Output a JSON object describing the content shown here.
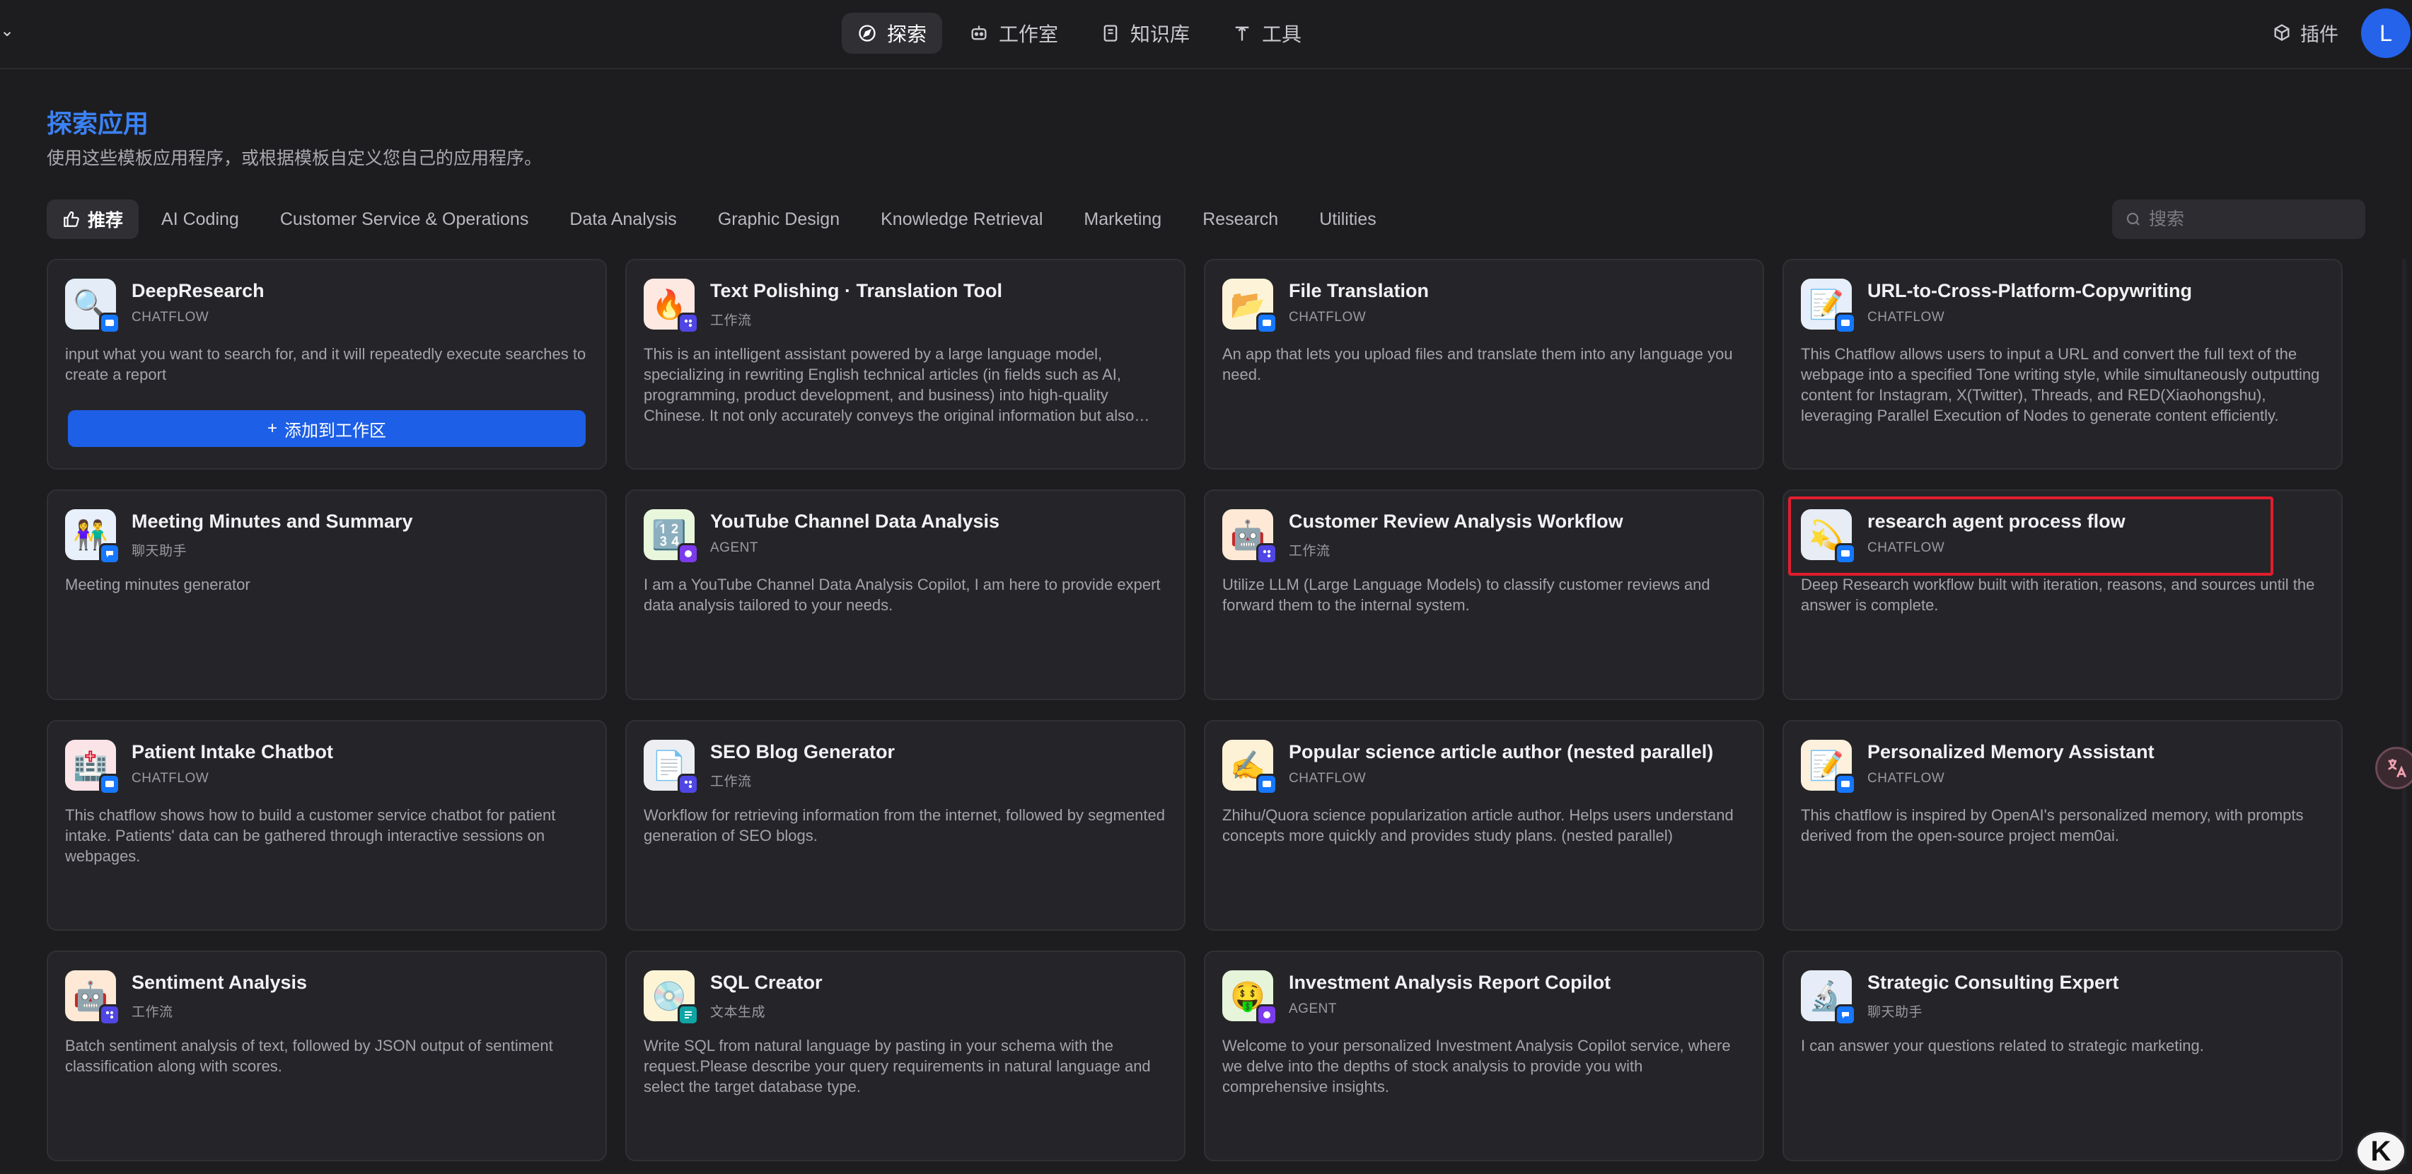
{
  "nav": {
    "items": [
      {
        "label": "探索",
        "icon": "compass-icon",
        "active": true
      },
      {
        "label": "工作室",
        "icon": "robot-icon",
        "active": false
      },
      {
        "label": "知识库",
        "icon": "book-icon",
        "active": false
      },
      {
        "label": "工具",
        "icon": "tool-icon",
        "active": false
      }
    ],
    "plugins_label": "插件",
    "avatar_letter": "L"
  },
  "page": {
    "title": "探索应用",
    "subtitle": "使用这些模板应用程序，或根据模板自定义您自己的应用程序。"
  },
  "categories": [
    {
      "label": "推荐",
      "active": true
    },
    {
      "label": "AI Coding"
    },
    {
      "label": "Customer Service & Operations"
    },
    {
      "label": "Data Analysis"
    },
    {
      "label": "Graphic Design"
    },
    {
      "label": "Knowledge Retrieval"
    },
    {
      "label": "Marketing"
    },
    {
      "label": "Research"
    },
    {
      "label": "Utilities"
    }
  ],
  "search": {
    "placeholder": "搜索"
  },
  "add_button_label": "添加到工作区",
  "cards": [
    {
      "name": "DeepResearch",
      "type": "CHATFLOW",
      "emoji": "🔍",
      "bg": "#e3ecf7",
      "badge": "#1677ff",
      "desc": "input what you want to search for, and it will repeatedly execute searches to create a report"
    },
    {
      "name": "Text Polishing · Translation Tool",
      "type": "工作流",
      "emoji": "🔥",
      "bg": "#fde8e2",
      "badge": "#4f46e5",
      "desc": "This is an intelligent assistant powered by a large language model, specializing in rewriting English technical articles (in fields such as AI, programming, product development, and business) into high-quality Chinese. It not only accurately conveys the original information but also ensures the translated text reads naturally and fluently."
    },
    {
      "name": "File Translation",
      "type": "CHATFLOW",
      "emoji": "📂",
      "bg": "#fdf3d8",
      "badge": "#1677ff",
      "desc": "An app that lets you upload files and translate them into any language you need."
    },
    {
      "name": "URL-to-Cross-Platform-Copywriting",
      "type": "CHATFLOW",
      "emoji": "📝",
      "bg": "#e6eefb",
      "badge": "#1677ff",
      "desc": "This Chatflow allows users to input a URL and convert the full text of the webpage into a specified Tone writing style, while simultaneously outputting content for Instagram, X(Twitter), Threads, and RED(Xiaohongshu), leveraging Parallel Execution of Nodes to generate content efficiently."
    },
    {
      "name": "Meeting Minutes and Summary",
      "type": "聊天助手",
      "emoji": "👫",
      "bg": "#e7f0fb",
      "badge": "#1677ff",
      "desc": "Meeting minutes generator"
    },
    {
      "name": "YouTube Channel Data Analysis",
      "type": "AGENT",
      "emoji": "🔢",
      "bg": "#e8f6dc",
      "badge": "#7c3aed",
      "desc": "I am a YouTube Channel Data Analysis Copilot, I am here to provide expert data analysis tailored to your needs."
    },
    {
      "name": "Customer Review Analysis Workflow",
      "type": "工作流",
      "emoji": "🤖",
      "bg": "#fde9d6",
      "badge": "#4f46e5",
      "desc": "Utilize LLM (Large Language Models) to classify customer reviews and forward them to the internal system."
    },
    {
      "name": "research agent process flow",
      "type": "CHATFLOW",
      "emoji": "💫",
      "bg": "#e7ecf5",
      "badge": "#1677ff",
      "desc": "Deep Research workflow built with iteration, reasons, and sources until the answer is complete."
    },
    {
      "name": "Patient Intake Chatbot",
      "type": "CHATFLOW",
      "emoji": "🏥",
      "bg": "#fbe4e8",
      "badge": "#1677ff",
      "desc": "This chatflow shows how to build a customer service chatbot for patient intake. Patients' data can be gathered through interactive sessions on webpages."
    },
    {
      "name": "SEO Blog Generator",
      "type": "工作流",
      "emoji": "📄",
      "bg": "#eceef2",
      "badge": "#4f46e5",
      "desc": "Workflow for retrieving information from the internet, followed by segmented generation of SEO blogs."
    },
    {
      "name": "Popular science article author (nested parallel)",
      "type": "CHATFLOW",
      "emoji": "✍️",
      "bg": "#fdf1d6",
      "badge": "#1677ff",
      "desc": "Zhihu/Quora science popularization article author. Helps users understand concepts more quickly and provides study plans. (nested parallel)"
    },
    {
      "name": "Personalized Memory Assistant",
      "type": "CHATFLOW",
      "emoji": "📝",
      "bg": "#fdf0dc",
      "badge": "#1677ff",
      "desc": "This chatflow is inspired by OpenAI's personalized memory, with prompts derived from the open-source project mem0ai."
    },
    {
      "name": "Sentiment Analysis",
      "type": "工作流",
      "emoji": "🤖",
      "bg": "#fde9d6",
      "badge": "#4f46e5",
      "desc": "Batch sentiment analysis of text, followed by JSON output of sentiment classification along with scores."
    },
    {
      "name": "SQL Creator",
      "type": "文本生成",
      "emoji": "💿",
      "bg": "#fdf4d6",
      "badge": "#0ea5a4",
      "desc": "Write SQL from natural language by pasting in your schema with the request.Please describe your query requirements in natural language and select the target database type."
    },
    {
      "name": "Investment Analysis Report Copilot",
      "type": "AGENT",
      "emoji": "🤑",
      "bg": "#e6f4da",
      "badge": "#7c3aed",
      "desc": "Welcome to your personalized Investment Analysis Copilot service, where we delve into the depths of stock analysis to provide you with comprehensive insights."
    },
    {
      "name": "Strategic Consulting Expert",
      "type": "聊天助手",
      "emoji": "🔬",
      "bg": "#e7edf8",
      "badge": "#1677ff",
      "desc": "I can answer your questions related to strategic marketing."
    }
  ]
}
